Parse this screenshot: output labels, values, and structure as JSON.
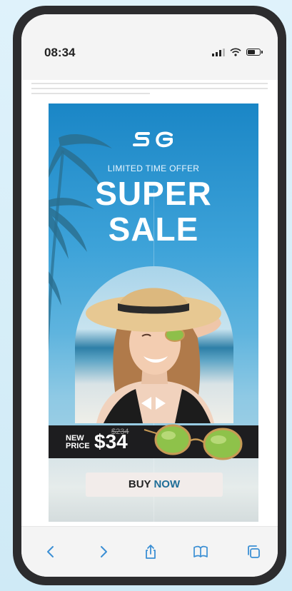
{
  "status_bar": {
    "time": "08:34"
  },
  "ad": {
    "logo_text": "SG",
    "tagline": "LIMITED TIME OFFER",
    "headline_line1": "SUPER",
    "headline_line2": "SALE",
    "old_price": "$234",
    "new_price_label_line1": "NEW",
    "new_price_label_line2": "PRICE",
    "new_price": "$34",
    "buy_button": {
      "part1": "BUY ",
      "part2": "NOW"
    }
  },
  "colors": {
    "accent": "#3b8fd4",
    "ad_blue": "#1a86c6",
    "price_band": "#1d1d1f",
    "button_bg": "#f2ecea",
    "button_now": "#1f6e98"
  },
  "toolbar": {
    "icons": [
      "back-icon",
      "forward-icon",
      "share-icon",
      "bookmarks-icon",
      "tabs-icon"
    ]
  }
}
